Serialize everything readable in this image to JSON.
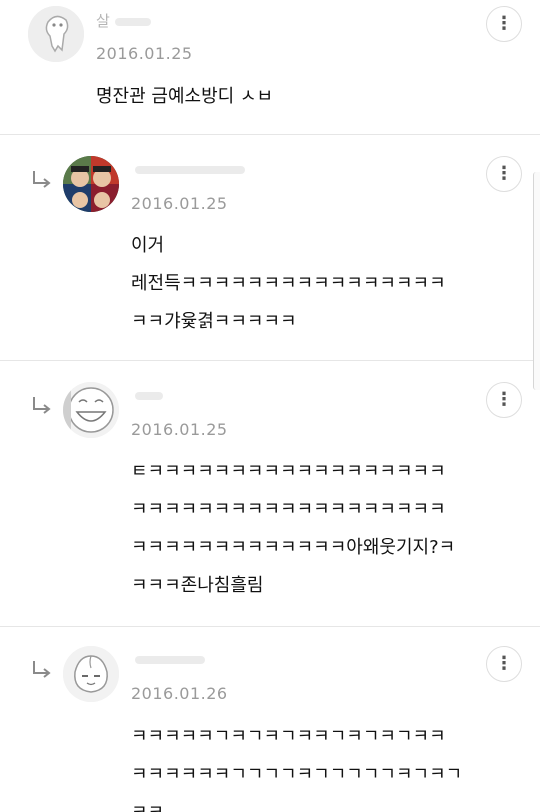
{
  "comments": [
    {
      "name": "살",
      "date": "2016.01.25",
      "lines": [
        "명잔관 금예소방디 ㅅㅂ"
      ],
      "avatar_icon": "ghost-character-icon",
      "is_reply": false
    },
    {
      "name": "",
      "date": "2016.01.25",
      "lines": [
        "이거",
        "레전득ㅋㅋㅋㅋㅋㅋㅋㅋㅋㅋㅋㅋㅋㅋㅋㅋ",
        "ㅋㅋ갸윷겱ㅋㅋㅋㅋㅋ"
      ],
      "avatar_icon": "photo-avatar-icon",
      "is_reply": true
    },
    {
      "name": "",
      "date": "2016.01.25",
      "lines": [
        "ㅌㅋㅋㅋㅋㅋㅋㅋㅋㅋㅋㅋㅋㅋㅋㅋㅋㅋㅋ",
        "ㅋㅋㅋㅋㅋㅋㅋㅋㅋㅋㅋㅋㅋㅋㅋㅋㅋㅋㅋ",
        "ㅋㅋㅋㅋㅋㅋㅋㅋㅋㅋㅋㅋㅋ아왜웃기지?ㅋ",
        "ㅋㅋㅋ존나침흘림"
      ],
      "avatar_icon": "laughing-character-icon",
      "is_reply": true
    },
    {
      "name": "",
      "date": "2016.01.26",
      "lines": [
        "ㅋㅋㅋㅋㅋㄱㅋㄱㅋㄱㅋㅋㄱㅋㄱㅋㄱㅋㅋ",
        "ㅋㅋㅋㅋㅋㅋㄱㄱㄱㄱㅋㄱㄱㄱㄱㄱㅋㄱㅋㄱ",
        "ㅋㅋ"
      ],
      "avatar_icon": "apeach-character-icon",
      "is_reply": true
    }
  ],
  "more_icon": "vertical-dots-icon",
  "reply_icon": "reply-arrow-icon",
  "colors": {
    "date": "#9a9a9a",
    "divider": "#e6e6e6",
    "text": "#111111"
  }
}
